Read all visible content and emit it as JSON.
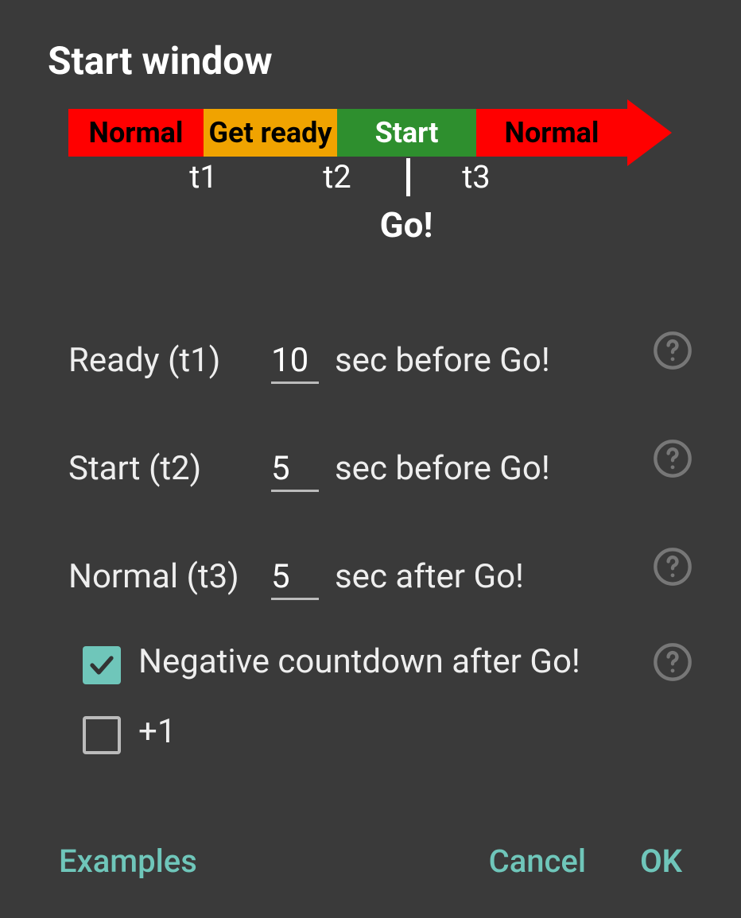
{
  "title": "Start window",
  "timeline": {
    "segments": {
      "normal1": "Normal",
      "ready": "Get ready",
      "start": "Start",
      "normal2": "Normal"
    },
    "ticks": {
      "t1": "t1",
      "t2": "t2",
      "t3": "t3"
    },
    "go_label": "Go!"
  },
  "rows": {
    "ready": {
      "label": "Ready (t1)",
      "value": "10",
      "suffix": "sec before Go!"
    },
    "start": {
      "label": "Start (t2)",
      "value": "5",
      "suffix": "sec before Go!"
    },
    "normal": {
      "label": "Normal (t3)",
      "value": "5",
      "suffix": "sec after Go!"
    }
  },
  "checks": {
    "negative": {
      "label": "Negative countdown after Go!",
      "checked": true
    },
    "plus1": {
      "label": "+1",
      "checked": false
    }
  },
  "buttons": {
    "examples": "Examples",
    "cancel": "Cancel",
    "ok": "OK"
  }
}
